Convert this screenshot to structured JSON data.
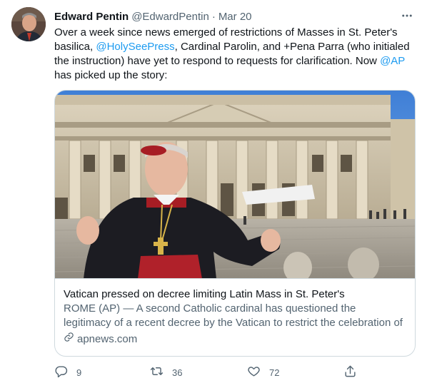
{
  "tweet": {
    "author_name": "Edward Pentin",
    "author_handle": "@EdwardPentin",
    "separator": "·",
    "time": "Mar 20",
    "text": {
      "p1": "Over a week since news emerged of restrictions of Masses in St. Peter's basilica, ",
      "m1": "@HolySeePress",
      "p2": ", Cardinal Parolin, and +Pena Parra (who initialed the instruction) have yet to respond to requests for clarification. Now ",
      "m2": "@AP",
      "p3": " has picked up the story:"
    }
  },
  "card": {
    "title": "Vatican pressed on decree limiting Latin Mass in St. Peter's",
    "description": "ROME (AP) — A second Catholic cardinal has questioned the legitimacy of a recent decree by the Vatican to restrict the celebration of the old …",
    "domain": "apnews.com"
  },
  "actions": {
    "reply_count": "9",
    "retweet_count": "36",
    "like_count": "72"
  },
  "icons": {
    "more": "more-horizontal-icon",
    "reply": "reply-icon",
    "retweet": "retweet-icon",
    "like": "heart-icon",
    "share": "share-icon",
    "link": "link-icon"
  },
  "colors": {
    "accent": "#1d9bf0",
    "text": "#0f1419",
    "secondary": "#536471",
    "border": "#cfd9de"
  }
}
